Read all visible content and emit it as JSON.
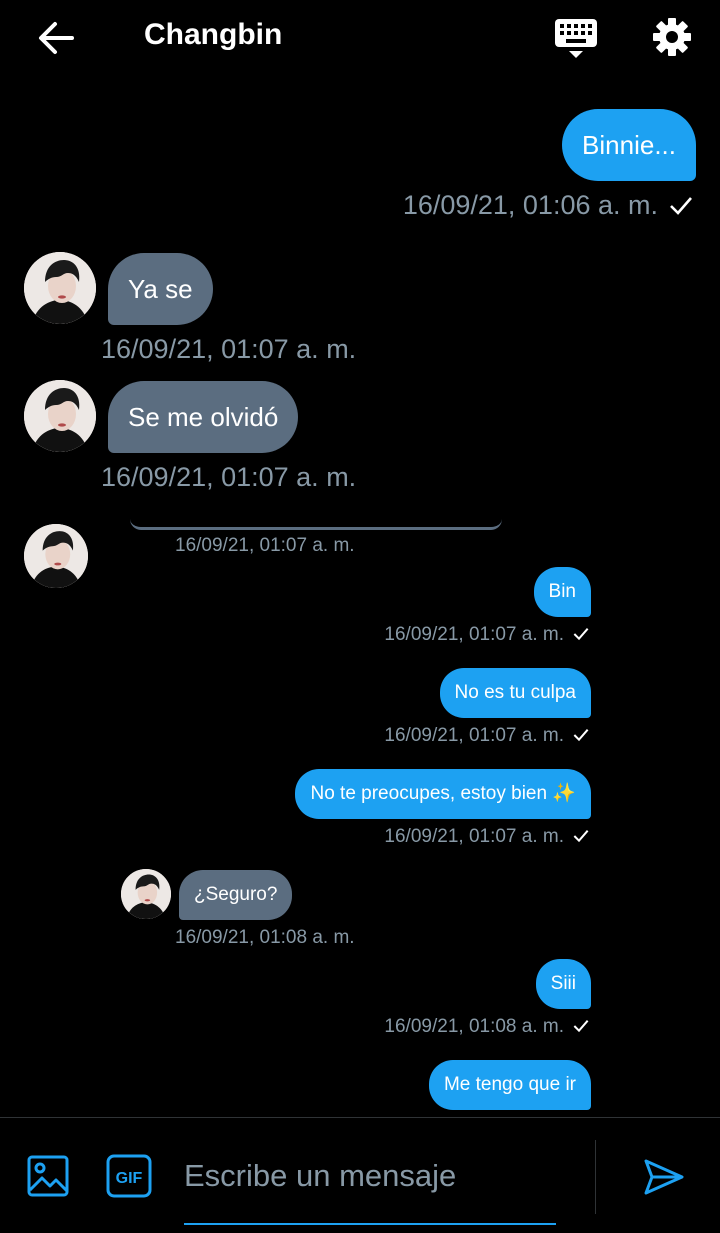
{
  "header": {
    "title": "Changbin"
  },
  "messages": [
    {
      "text": "Binnie...",
      "time": "16/09/21, 01:06 a. m.",
      "sender": "me"
    },
    {
      "text": "Ya se",
      "time": "16/09/21, 01:07 a. m.",
      "sender": "them"
    },
    {
      "text": "Se me olvidó",
      "time": "16/09/21, 01:07 a. m.",
      "sender": "them"
    },
    {
      "text": "",
      "time": "16/09/21, 01:07 a. m.",
      "sender": "them"
    },
    {
      "text": "Bin",
      "time": "16/09/21, 01:07 a. m.",
      "sender": "me"
    },
    {
      "text": "No es tu culpa",
      "time": "16/09/21, 01:07 a. m.",
      "sender": "me"
    },
    {
      "text": "No te preocupes, estoy bien ✨",
      "time": "16/09/21, 01:07 a. m.",
      "sender": "me"
    },
    {
      "text": "¿Seguro?",
      "time": "16/09/21, 01:08 a. m.",
      "sender": "them"
    },
    {
      "text": "Siii",
      "time": "16/09/21, 01:08 a. m.",
      "sender": "me"
    },
    {
      "text": "Me tengo que ir",
      "sender": "me"
    }
  ],
  "composer": {
    "placeholder": "Escribe un mensaje"
  },
  "colors": {
    "accent": "#1da1f2",
    "incoming_bubble": "#5b6d80",
    "timestamp": "#8899a6",
    "background": "#000000"
  },
  "icons": [
    "back-arrow-icon",
    "keyboard-icon",
    "gear-icon",
    "image-icon",
    "gif-icon",
    "send-icon",
    "check-icon"
  ]
}
